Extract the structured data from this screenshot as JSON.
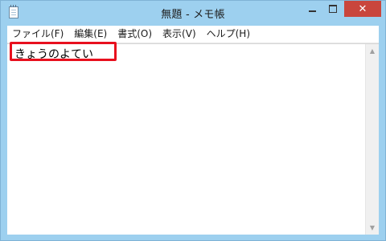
{
  "window": {
    "title": "無題 - メモ帳",
    "close_glyph": "✕"
  },
  "menu": [
    {
      "label": "ファイル(F)"
    },
    {
      "label": "編集(E)"
    },
    {
      "label": "書式(O)"
    },
    {
      "label": "表示(V)"
    },
    {
      "label": "ヘルプ(H)"
    }
  ],
  "editor": {
    "text": "きょうのよてい"
  },
  "scrollbar": {
    "up_glyph": "▲",
    "down_glyph": "▼"
  },
  "colors": {
    "titlebar": "#9dd0ef",
    "close_button": "#c9463d",
    "highlight": "#e8101e"
  }
}
